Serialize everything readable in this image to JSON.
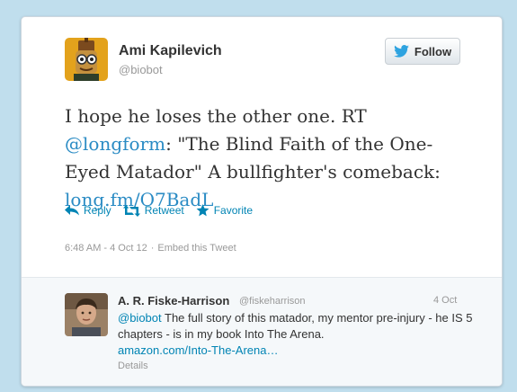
{
  "tweet": {
    "author_name": "Ami Kapilevich",
    "author_handle": "@biobot",
    "follow_label": "Follow",
    "text_before": "I hope he loses the other one. RT ",
    "mention": "@longform",
    "text_middle": ": \"The Blind Faith of the One-Eyed Matador\" A bullfighter's comeback: ",
    "link": "long.fm/O7BadL",
    "actions": {
      "reply": "Reply",
      "retweet": "Retweet",
      "favorite": "Favorite"
    },
    "timestamp": "6:48 AM - 4 Oct 12",
    "separator": "·",
    "embed_label": "Embed this Tweet"
  },
  "reply": {
    "author_name": "A. R. Fiske-Harrison",
    "author_handle": "@fiskeharrison",
    "date": "4 Oct",
    "mention": "@biobot",
    "text": " The full story of this matador, my mentor pre-injury - he IS 5 chapters - is in my book Into The Arena.",
    "link": "amazon.com/Into-The-Arena…",
    "details_label": "Details"
  },
  "colors": {
    "background": "#c0deed",
    "link": "#0084b4",
    "muted": "#999999"
  },
  "icons": {
    "follow": "twitter-bird-icon",
    "reply": "reply-arrow-icon",
    "retweet": "retweet-icon",
    "favorite": "star-icon"
  }
}
